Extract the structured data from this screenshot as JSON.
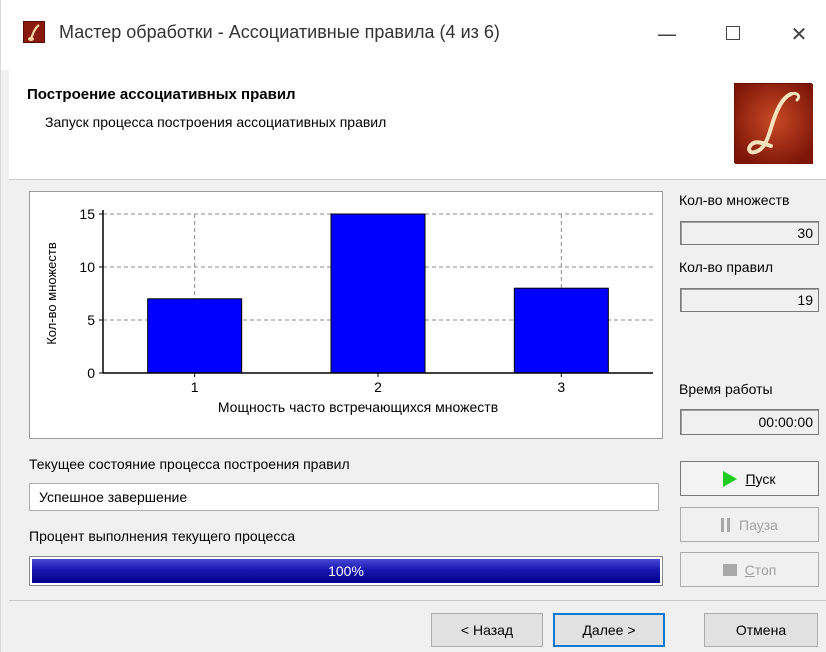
{
  "window": {
    "title": "Мастер обработки - Ассоциативные правила (4 из 6)",
    "minimize_glyph": "—",
    "close_glyph": "✕"
  },
  "header": {
    "title": "Построение ассоциативных правил",
    "subtitle": "Запуск процесса построения ассоциативных правил"
  },
  "chart_data": {
    "type": "bar",
    "categories": [
      "1",
      "2",
      "3"
    ],
    "values": [
      7,
      15,
      8
    ],
    "title": "",
    "xlabel": "Мощность часто встречающихся множеств",
    "ylabel": "Кол-во множеств",
    "ylim": [
      0,
      15
    ],
    "yticks": [
      0,
      5,
      10,
      15
    ],
    "grid": true,
    "bar_color": "#0000ff"
  },
  "stats": {
    "sets_label": "Кол-во множеств",
    "sets_value": "30",
    "rules_label": "Кол-во правил",
    "rules_value": "19",
    "time_label": "Время работы",
    "time_value": "00:00:00"
  },
  "status": {
    "state_label": "Текущее состояние процесса построения правил",
    "state_value": "Успешное завершение",
    "percent_label": "Процент выполнения текущего процесса",
    "progress_text": "100%",
    "progress_fraction": 1.0
  },
  "controls": {
    "start": {
      "first": "П",
      "rest": "уск",
      "icon": "play-icon",
      "enabled": true
    },
    "pause": {
      "first": "Па",
      "mid": "у",
      "rest": "за",
      "icon": "pause-icon",
      "enabled": false
    },
    "stop": {
      "first": "С",
      "rest": "топ",
      "icon": "stop-icon",
      "enabled": false
    }
  },
  "nav": {
    "back": "< Назад",
    "next": "Далее >",
    "cancel": "Отмена"
  },
  "colors": {
    "accent": "#0a78d7",
    "progress": "#0000a0",
    "logo": "#a42a14"
  }
}
